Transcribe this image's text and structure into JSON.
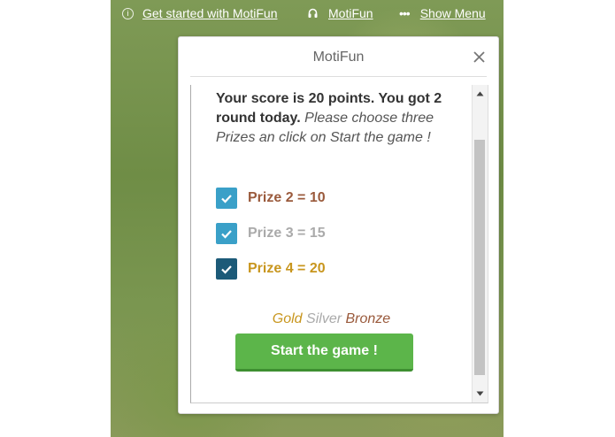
{
  "topbar": {
    "get_started_label": "Get started with MotiFun",
    "app_link_label": "MotiFun",
    "menu_label": "Show Menu"
  },
  "dialog": {
    "title": "MotiFun",
    "message_bold": "Your score is 20 points. You got 2 round today.",
    "message_italic": "Please choose three Prizes an click on Start the game !",
    "prizes": [
      {
        "label": "Prize 2 = 10",
        "checked": true,
        "color": "#9a5a3c",
        "box_color": "#3aa0c8"
      },
      {
        "label": "Prize 3 = 15",
        "checked": true,
        "color": "#aaaaaa",
        "box_color": "#3aa0c8"
      },
      {
        "label": "Prize 4 = 20",
        "checked": true,
        "color": "#c8961e",
        "box_color": "#1c5a78"
      }
    ],
    "medals": {
      "gold": "Gold",
      "silver": "Silver",
      "bronze": "Bronze",
      "gold_color": "#c8961e",
      "silver_color": "#aaaaaa",
      "bronze_color": "#9a5a3c"
    },
    "start_button_label": "Start the game !"
  },
  "icons": [
    "info-icon",
    "headset-icon",
    "dots-icon",
    "close-icon",
    "check-icon",
    "arrow-up-icon",
    "arrow-down-icon"
  ],
  "colors": {
    "accent_button": "#5cb54a"
  }
}
